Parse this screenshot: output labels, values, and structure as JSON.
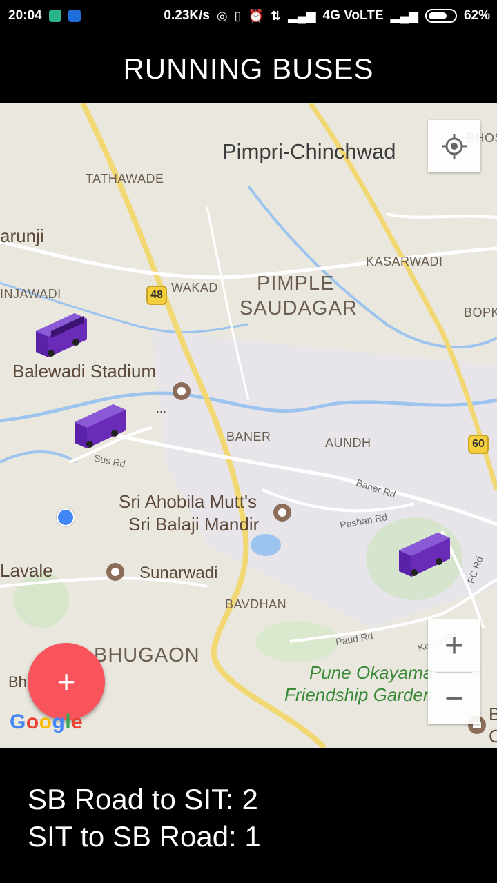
{
  "status_bar": {
    "time": "20:04",
    "speed": "0.23K/s",
    "network": "4G VoLTE",
    "battery": "62%",
    "icons": [
      "android-icon",
      "notification-icon",
      "sync-icon",
      "vibrate-off-icon",
      "alarm-icon",
      "data-icon",
      "signal-icon",
      "battery-icon"
    ]
  },
  "app_bar": {
    "title": "RUNNING BUSES"
  },
  "map": {
    "labels": {
      "pimpri": "Pimpri-Chinchwad",
      "tathawade": "TATHAWADE",
      "marunji": "arunji",
      "hinjawadi": "INJAWADI",
      "wakad": "WAKAD",
      "pimple": "PIMPLE",
      "saudagar": "SAUDAGAR",
      "kasarwadi": "KASARWADI",
      "bopk": "BOPK",
      "bhos": "BHOS",
      "balewadi": "Balewadi Stadium",
      "dots": "...",
      "baner": "BANER",
      "aundh": "AUNDH",
      "sus_rd": "Sus Rd",
      "baner_rd": "Baner Rd",
      "pashan_rd": "Pashan Rd",
      "sri1": "Sri Ahobila Mutt's",
      "sri2": "Sri Balaji Mandir",
      "lavale": "Lavale",
      "sunarwadi": "Sunarwadi",
      "bavdhan": "BAVDHAN",
      "fc_rd": "FC Rd",
      "paud_rd": "Paud Rd",
      "karve_rd": "Karve Rd",
      "bhugaon": "BHUGAON",
      "bh": "Bh",
      "okayama1": "Pune Okayama",
      "okayama2": "Friendship Garden",
      "b_right": "B",
      "c_right": "C"
    },
    "shields": {
      "nh48": "48",
      "nh60": "60"
    },
    "controls": {
      "my_location": "my-location-icon",
      "zoom_in": "+",
      "zoom_out": "−"
    },
    "fab": "+",
    "attribution": [
      "G",
      "o",
      "o",
      "g",
      "l",
      "e"
    ]
  },
  "summary": {
    "line1": "SB Road to SIT: 2",
    "line2": "SIT to SB Road: 1"
  },
  "colors": {
    "fab": "#f9545c",
    "bus": "#6a2bb8",
    "location_dot": "#4285f4",
    "map_bg": "#eae7df"
  }
}
